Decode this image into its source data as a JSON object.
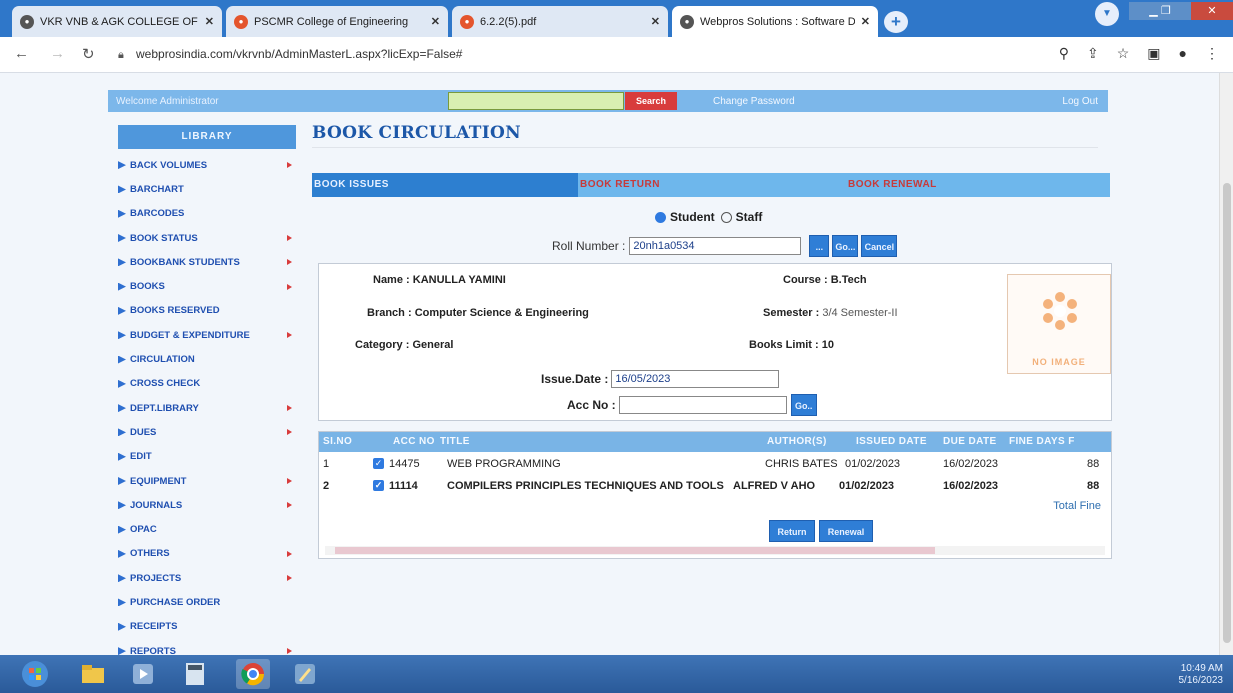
{
  "browser": {
    "tabs": [
      {
        "title": "VKR VNB & AGK COLLEGE OF E",
        "active": false
      },
      {
        "title": "PSCMR College of Engineering",
        "active": false
      },
      {
        "title": "6.2.2(5).pdf",
        "active": false
      },
      {
        "title": "Webpros Solutions : Software D",
        "active": true
      }
    ],
    "url": "webprosindia.com/vkrvnb/AdminMasterL.aspx?licExp=False#"
  },
  "topstrip": {
    "welcome": "Welcome Administrator",
    "search_value": "",
    "search_label": "Search",
    "change_password": "Change Password",
    "logout": "Log Out"
  },
  "sidebar": {
    "header": "LIBRARY",
    "items": [
      {
        "label": "BACK VOLUMES",
        "submenu": true
      },
      {
        "label": "BARCHART",
        "submenu": false
      },
      {
        "label": "BARCODES",
        "submenu": false
      },
      {
        "label": "BOOK STATUS",
        "submenu": true
      },
      {
        "label": "BOOKBANK STUDENTS",
        "submenu": true
      },
      {
        "label": "BOOKS",
        "submenu": true
      },
      {
        "label": "BOOKS RESERVED",
        "submenu": false
      },
      {
        "label": "BUDGET & EXPENDITURE",
        "submenu": true
      },
      {
        "label": "CIRCULATION",
        "submenu": false
      },
      {
        "label": "CROSS CHECK",
        "submenu": false
      },
      {
        "label": "DEPT.LIBRARY",
        "submenu": true
      },
      {
        "label": "DUES",
        "submenu": true
      },
      {
        "label": "EDIT",
        "submenu": false
      },
      {
        "label": "EQUIPMENT",
        "submenu": true
      },
      {
        "label": "JOURNALS",
        "submenu": true
      },
      {
        "label": "OPAC",
        "submenu": false
      },
      {
        "label": "OTHERS",
        "submenu": true
      },
      {
        "label": "PROJECTS",
        "submenu": true
      },
      {
        "label": "PURCHASE ORDER",
        "submenu": false
      },
      {
        "label": "RECEIPTS",
        "submenu": false
      },
      {
        "label": "REPORTS",
        "submenu": true
      }
    ]
  },
  "main": {
    "title": "BOOK CIRCULATION",
    "tabs": [
      "BOOK ISSUES",
      "BOOK RETURN",
      "BOOK RENEWAL"
    ],
    "radio_student": "Student",
    "radio_staff": "Staff",
    "roll_label": "Roll Number :",
    "roll_value": "20nh1a0534",
    "lookup_btn": "...",
    "go_btn": "Go...",
    "cancel_btn": "Cancel",
    "student": {
      "name_label": "Name :",
      "name": "KANULLA YAMINI",
      "course_label": "Course :",
      "course": "B.Tech",
      "branch_label": "Branch :",
      "branch": "Computer Science & Engineering",
      "semester_label": "Semester :",
      "semester": "3/4 Semester-II",
      "category_label": "Category :",
      "category": "General",
      "books_limit_label": "Books Limit :",
      "books_limit": "10",
      "no_image": "NO IMAGE"
    },
    "issue_date_label": "Issue.Date :",
    "issue_date": "16/05/2023",
    "acc_no_label": "Acc No :",
    "acc_no_value": "",
    "acc_go": "Go..",
    "table": {
      "headers": [
        "SI.NO",
        "ACC NO",
        "TITLE",
        "AUTHOR(S)",
        "ISSUED DATE",
        "DUE DATE",
        "FINE DAYS F"
      ],
      "rows": [
        {
          "sno": "1",
          "acc": "14475",
          "title": "WEB PROGRAMMING",
          "author": "CHRIS BATES",
          "issued": "01/02/2023",
          "due": "16/02/2023",
          "fine_days": "88"
        },
        {
          "sno": "2",
          "acc": "11114",
          "title": "COMPILERS PRINCIPLES TECHNIQUES AND TOOLS",
          "author": "ALFRED V AHO",
          "issued": "01/02/2023",
          "due": "16/02/2023",
          "fine_days": "88"
        }
      ],
      "total_fine": "Total Fine"
    },
    "return_btn": "Return",
    "renewal_btn": "Renewal"
  },
  "taskbar": {
    "time": "10:49 AM",
    "date": "5/16/2023"
  },
  "colors": {
    "accent": "#2d7fd0",
    "title": "#1c57a8",
    "search": "#d83c3c"
  }
}
